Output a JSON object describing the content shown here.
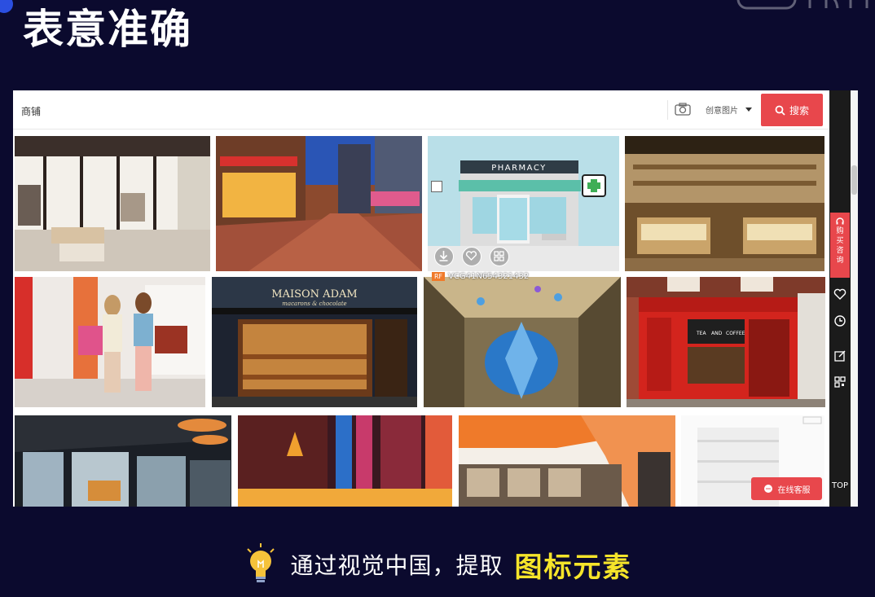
{
  "slide": {
    "title": "表意准确",
    "caption_prefix": "通过视觉中国，提取",
    "caption_highlight": "图标元素"
  },
  "search": {
    "query": "商铺",
    "type_option": "创意图片",
    "button_label": "搜索"
  },
  "results": [
    {
      "id": "tile-clothing-store"
    },
    {
      "id": "tile-street-night"
    },
    {
      "id": "tile-pharmacy",
      "image_text": "PHARMACY",
      "badge": "RF",
      "vcg_id": "VCG41N654321432"
    },
    {
      "id": "tile-grocery-interior"
    },
    {
      "id": "tile-shopping-women"
    },
    {
      "id": "tile-maison-adam",
      "sign_title": "MAISON ADAM",
      "sign_subtitle": "macarons & chocolate"
    },
    {
      "id": "tile-mall-atrium"
    },
    {
      "id": "tile-red-shopfront",
      "signs": [
        "TEA",
        "AND",
        "COFFEE"
      ]
    },
    {
      "id": "tile-glass-shops"
    },
    {
      "id": "tile-neon-street"
    },
    {
      "id": "tile-mall-corridor"
    },
    {
      "id": "tile-empty-shelf"
    }
  ],
  "sidebar": {
    "buy_label": [
      "购",
      "买",
      "咨",
      "询"
    ],
    "top_label": "TOP"
  },
  "chat": {
    "label": "在线客服"
  },
  "colors": {
    "accent": "#e8474c",
    "slide_bg": "#0b0a2e",
    "highlight": "#f5e42a"
  }
}
